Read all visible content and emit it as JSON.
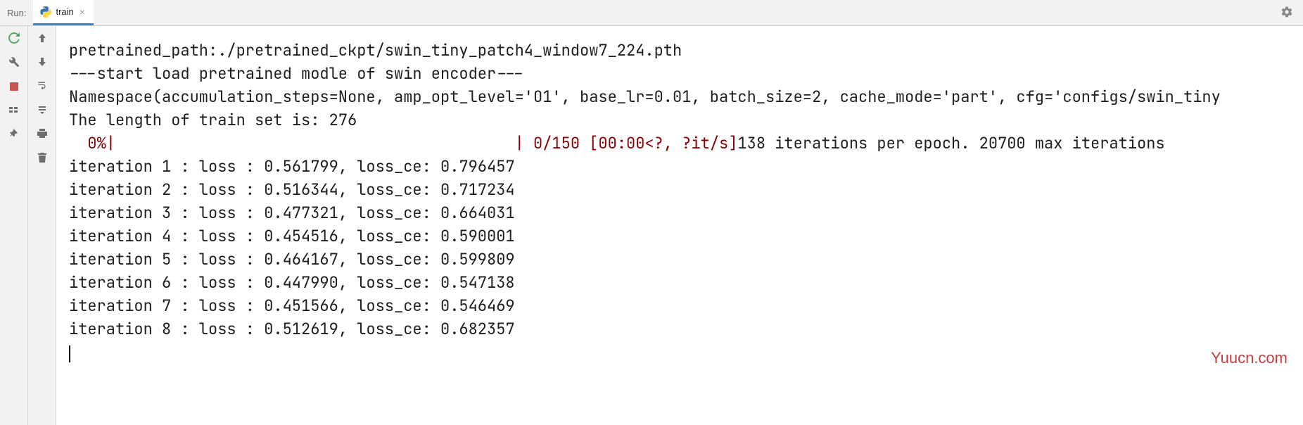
{
  "header": {
    "label": "Run:",
    "tab": {
      "title": "train",
      "close": "×"
    }
  },
  "console": {
    "line_pretrained": "pretrained_path:./pretrained_ckpt/swin_tiny_patch4_window7_224.pth",
    "line_start": "---start load pretrained modle of swin encoder---",
    "line_namespace": "Namespace(accumulation_steps=None, amp_opt_level='O1', base_lr=0.01, batch_size=2, cache_mode='part', cfg='configs/swin_tiny",
    "line_length": "The length of train set is: 276",
    "progress_left": "  0%|",
    "progress_right": "                                           | 0/150 [00:00<?, ?it/s]",
    "progress_tail": "138 iterations per epoch. 20700 max iterations",
    "iterations": [
      "iteration 1 : loss : 0.561799, loss_ce: 0.796457",
      "iteration 2 : loss : 0.516344, loss_ce: 0.717234",
      "iteration 3 : loss : 0.477321, loss_ce: 0.664031",
      "iteration 4 : loss : 0.454516, loss_ce: 0.590001",
      "iteration 5 : loss : 0.464167, loss_ce: 0.599809",
      "iteration 6 : loss : 0.447990, loss_ce: 0.547138",
      "iteration 7 : loss : 0.451566, loss_ce: 0.546469",
      "iteration 8 : loss : 0.512619, loss_ce: 0.682357"
    ]
  },
  "watermark": "Yuucn.com"
}
